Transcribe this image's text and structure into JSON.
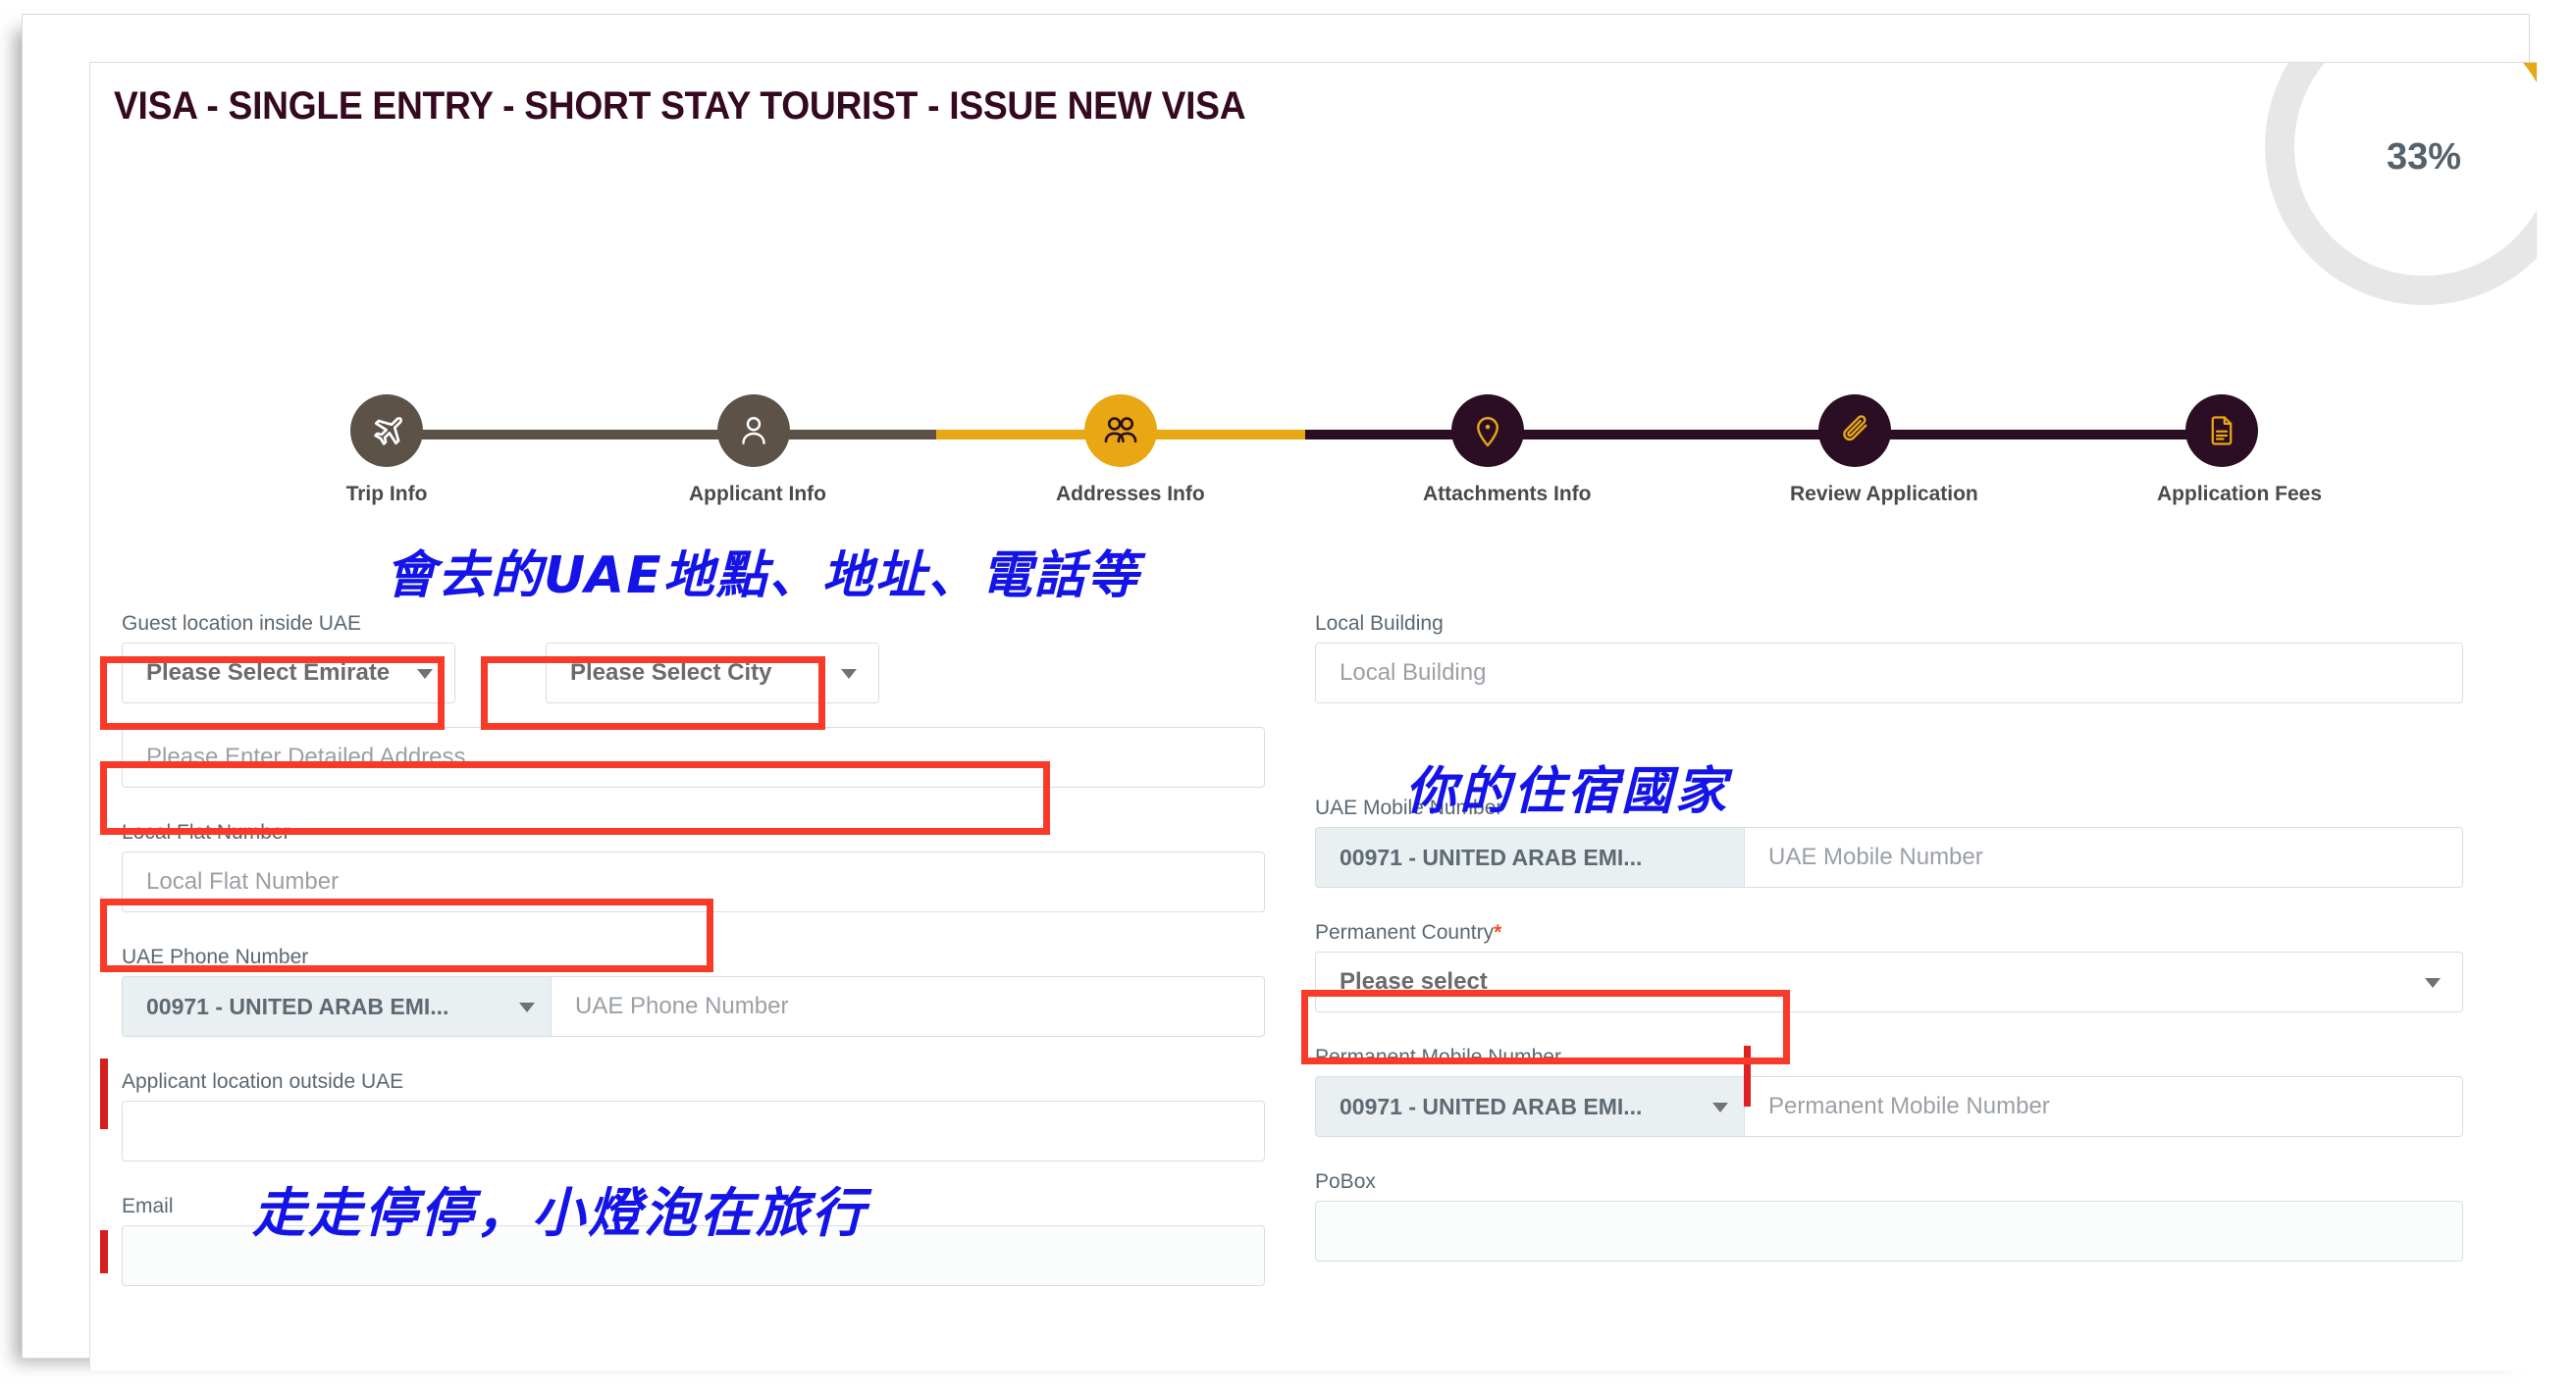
{
  "header": {
    "title": "VISA - SINGLE ENTRY - SHORT STAY TOURIST - ISSUE NEW VISA",
    "progress_percent": "33%",
    "progress_value": 33,
    "accent_color": "#e8a713",
    "track_color": "#e7e7e7",
    "title_color": "#35091f"
  },
  "stepper": {
    "steps": [
      {
        "label": "Trip Info",
        "state": "done",
        "icon": "airplane-icon"
      },
      {
        "label": "Applicant Info",
        "state": "done",
        "icon": "person-icon"
      },
      {
        "label": "Addresses Info",
        "state": "active",
        "icon": "people-icon"
      },
      {
        "label": "Attachments Info",
        "state": "todo",
        "icon": "location-pin-icon"
      },
      {
        "label": "Review Application",
        "state": "todo",
        "icon": "paperclip-icon"
      },
      {
        "label": "Application Fees",
        "state": "todo",
        "icon": "document-icon"
      }
    ],
    "colors": {
      "done": "#5d5248",
      "active": "#e8a713",
      "todo": "#2b0e23"
    }
  },
  "form": {
    "guest_location": {
      "label": "Guest location inside UAE",
      "emirate_value": "Please Select Emirate",
      "city_value": "Please Select City"
    },
    "detailed_address": {
      "placeholder": "Please Enter Detailed Address"
    },
    "local_building": {
      "label": "Local Building",
      "placeholder": "Local Building"
    },
    "local_flat": {
      "label": "Local Flat Number",
      "placeholder": "Local Flat Number"
    },
    "uae_mobile": {
      "label": "UAE Mobile Number",
      "prefix": "00971 - UNITED ARAB EMI...",
      "placeholder": "UAE Mobile Number"
    },
    "uae_phone": {
      "label": "UAE Phone Number",
      "prefix": "00971 - UNITED ARAB EMI...",
      "placeholder": "UAE Phone Number"
    },
    "permanent_country": {
      "label": "Permanent Country",
      "required_mark": "*",
      "value": "Please select"
    },
    "applicant_location_outside": {
      "label": "Applicant location outside UAE",
      "value": ""
    },
    "permanent_mobile": {
      "label": "Permanent Mobile Number",
      "prefix": "00971 - UNITED ARAB EMI...",
      "placeholder": "Permanent Mobile Number"
    },
    "email": {
      "label": "Email"
    },
    "pobox": {
      "label": "PoBox"
    }
  },
  "annotations": {
    "note_address": "會去的UAE地點、地址、電話等",
    "note_country": "你的住宿國家",
    "watermark": "走走停停，小燈泡在旅行",
    "highlight_color": "#f93a29",
    "ink_color": "#1414e8"
  }
}
